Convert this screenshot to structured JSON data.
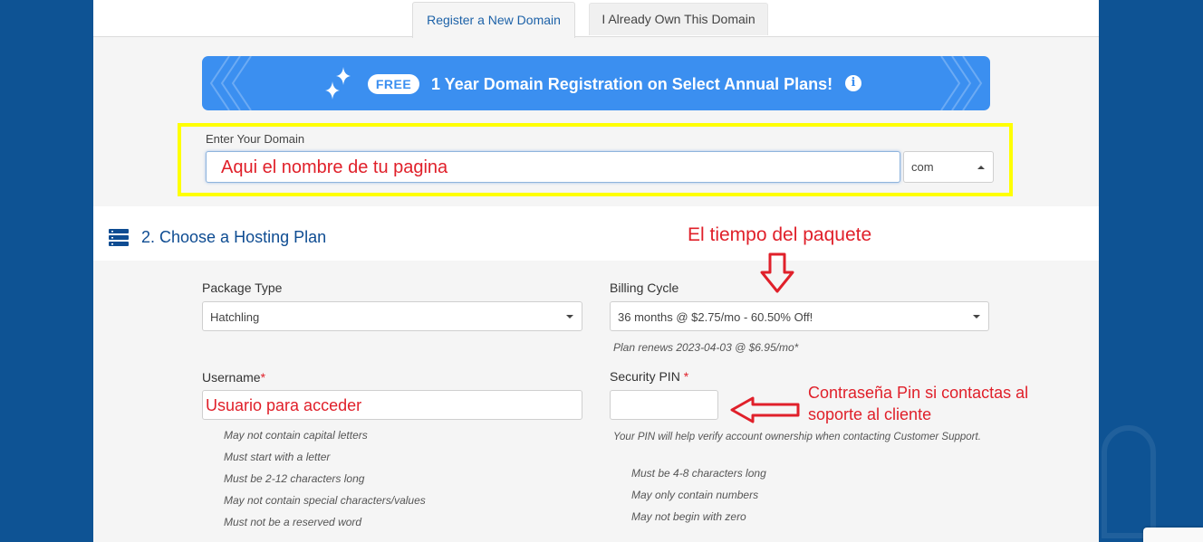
{
  "tabs": {
    "register": "Register a New Domain",
    "own": "I Already Own This Domain"
  },
  "promo": {
    "badge": "FREE",
    "text": "1 Year Domain Registration on Select Annual Plans!",
    "info_icon": "info-circle-icon"
  },
  "domain": {
    "label": "Enter Your Domain",
    "value": "Aqui el nombre de tu pagina",
    "tld": "com"
  },
  "section": {
    "icon": "server-stack-icon",
    "title": "2. Choose a Hosting Plan"
  },
  "package": {
    "label": "Package Type",
    "value": "Hatchling"
  },
  "billing": {
    "label": "Billing Cycle",
    "value": "36 months @ $2.75/mo - 60.50% Off!",
    "renew_note": "Plan renews 2023-04-03 @ $6.95/mo*"
  },
  "username": {
    "label": "Username",
    "required_mark": "*",
    "value": "Usuario para acceder",
    "rules": [
      "May not contain capital letters",
      "Must start with a letter",
      "Must be 2-12 characters long",
      "May not contain special characters/values",
      "Must not be a reserved word"
    ]
  },
  "pin": {
    "label": "Security PIN",
    "required_mark": "*",
    "value": "",
    "help": "Your PIN will help verify account ownership when contacting Customer Support.",
    "rules": [
      "Must be 4-8 characters long",
      "May only contain numbers",
      "May not begin with zero"
    ]
  },
  "annotations": {
    "billing_note": "El tiempo del paquete",
    "pin_note_line1": "Contraseña Pin si contactas al",
    "pin_note_line2": "soporte al cliente"
  },
  "colors": {
    "page_bg": "#0e5394",
    "promo_bg": "#3b8ff0",
    "highlight": "#ffff00",
    "annotation": "#e0202a",
    "accent": "#1d62a8"
  }
}
